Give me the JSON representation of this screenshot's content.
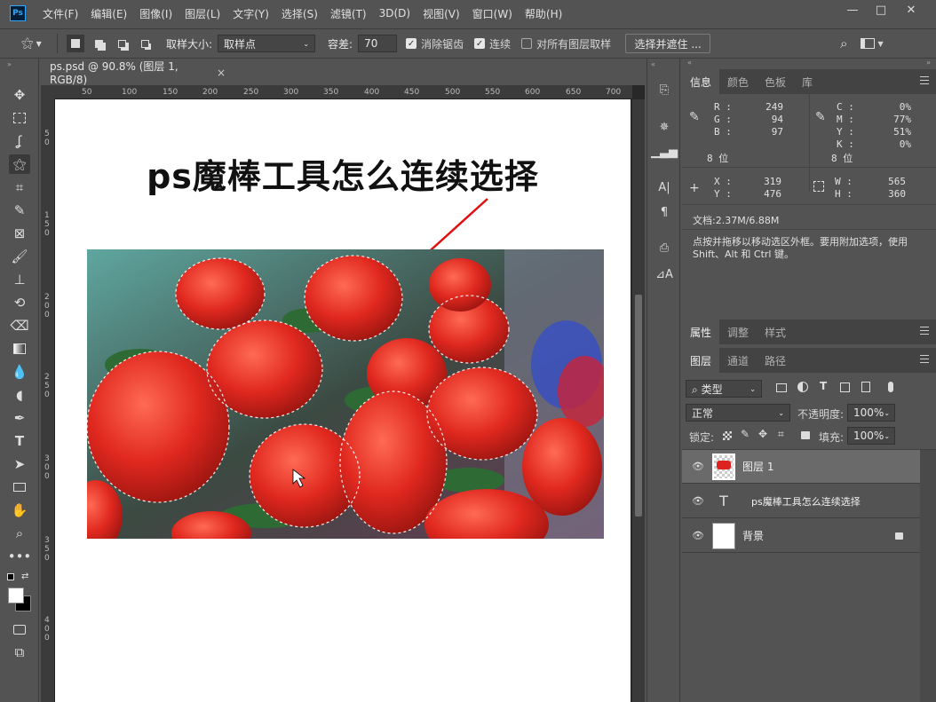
{
  "app": {
    "logo": "Ps"
  },
  "menu": [
    "文件(F)",
    "编辑(E)",
    "图像(I)",
    "图层(L)",
    "文字(Y)",
    "选择(S)",
    "滤镜(T)",
    "3D(D)",
    "视图(V)",
    "窗口(W)",
    "帮助(H)"
  ],
  "window_controls": {
    "minimize": "—",
    "restore": "□",
    "close": "✕"
  },
  "options": {
    "sample_size_label": "取样大小:",
    "sample_size_value": "取样点",
    "tolerance_label": "容差:",
    "tolerance_value": "70",
    "antialias_label": "消除锯齿",
    "contiguous_label": "连续",
    "sample_all_label": "对所有图层取样",
    "select_mask_label": "选择并遮住 ..."
  },
  "document": {
    "tab_title": "ps.psd @ 90.8% (图层 1, RGB/8)",
    "close": "×",
    "hruler_labels": [
      "50",
      "100",
      "150",
      "200",
      "250",
      "300",
      "350",
      "400",
      "450",
      "500",
      "550",
      "600",
      "650",
      "700"
    ],
    "vruler_labels": [
      "5",
      "0",
      "1",
      "5",
      "0",
      "2",
      "0",
      "0",
      "2",
      "5",
      "0",
      "3",
      "0",
      "0",
      "3",
      "5",
      "0",
      "4",
      "0",
      "0"
    ],
    "heading": "ps魔棒工具怎么连续选择"
  },
  "info_panel": {
    "tabs": [
      "信息",
      "颜色",
      "色板",
      "库"
    ],
    "R": "249",
    "G": "94",
    "B": "97",
    "C": "0%",
    "M": "77%",
    "Y": "51%",
    "K": "0%",
    "bit_left": "8 位",
    "bit_right": "8 位",
    "X": "319",
    "Yc": "476",
    "W": "565",
    "H": "360",
    "doc_size": "文档:2.37M/6.88M",
    "hint": "点按并拖移以移动选区外框。要用附加选项，使用 Shift、Alt 和 Ctrl 键。",
    "labels": {
      "R": "R :",
      "G": "G :",
      "B": "B :",
      "C": "C :",
      "M": "M :",
      "Y": "Y :",
      "K": "K :",
      "X": "X :",
      "Yc": "Y :",
      "W": "W :",
      "H": "H :"
    }
  },
  "props_panel": {
    "tabs": [
      "属性",
      "调整",
      "样式"
    ]
  },
  "layers_panel": {
    "tabs": [
      "图层",
      "通道",
      "路径"
    ],
    "filter_label": "类型",
    "blend_mode": "正常",
    "opacity_label": "不透明度:",
    "opacity_value": "100%",
    "lock_label": "锁定:",
    "fill_label": "填充:",
    "fill_value": "100%",
    "layers": [
      {
        "name": "图层 1",
        "type": "pixel"
      },
      {
        "name": "ps魔棒工具怎么连续选择",
        "type": "text"
      },
      {
        "name": "背景",
        "type": "background"
      }
    ],
    "text_layer_icon": "T"
  }
}
